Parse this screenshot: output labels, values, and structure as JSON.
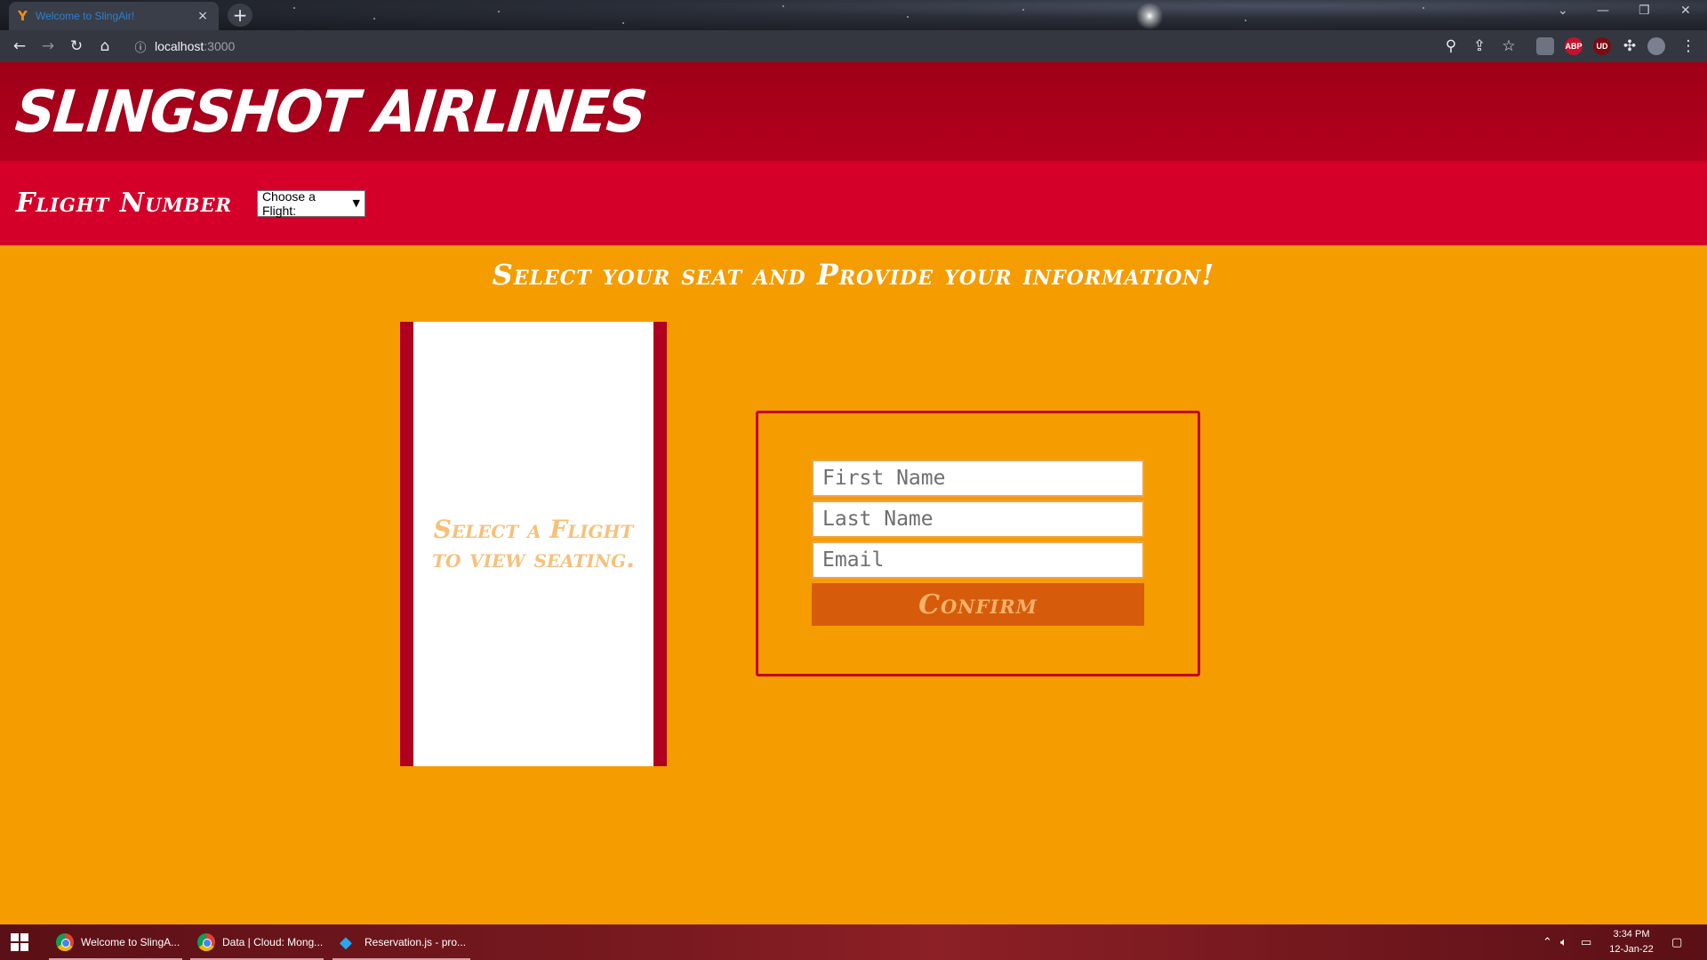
{
  "browser": {
    "tab_title": "Welcome to SlingAir!",
    "tab_favicon": "Y",
    "tab_close": "×",
    "new_tab": "+",
    "url_host": "localhost",
    "url_port": ":3000",
    "nav_icons": {
      "back": "←",
      "forward": "→",
      "reload": "↻",
      "home": "⌂",
      "info": "ⓘ"
    },
    "toolbar_icons": {
      "zoom": "⚲",
      "share": "⇪",
      "bookmark": "☆",
      "extensions": "✣",
      "menu": "⋮"
    },
    "ext_labels": [
      "ABP",
      "UD"
    ],
    "window_controls": {
      "minimize": "—",
      "maximize": "❐",
      "close": "✕",
      "tabsearch": "⌄"
    }
  },
  "page": {
    "logo": "SLINGSHOT AIRLINES",
    "flight_label": "Flight Number",
    "flight_select": "Choose a Flight:",
    "subheading": "Select your seat and Provide your information!",
    "seat_message_line1": "Select a Flight",
    "seat_message_line2": "to view seating.",
    "form": {
      "first_name_placeholder": "First Name",
      "last_name_placeholder": "Last Name",
      "email_placeholder": "Email",
      "confirm_label": "Confirm"
    }
  },
  "taskbar": {
    "apps": [
      {
        "label": "Welcome to SlingA..."
      },
      {
        "label": "Data | Cloud: Mong..."
      },
      {
        "label": "Reservation.js - pro..."
      }
    ],
    "time": "3:34 PM",
    "date": "12-Jan-22"
  },
  "colors": {
    "header_bg": "#a8001d",
    "flight_bar_bg": "#d4002a",
    "page_bg": "#f59c00",
    "seat_border": "#b0001f",
    "seat_text": "#f7c07a",
    "form_border": "#c4001f",
    "confirm_bg": "#d65c0c",
    "confirm_text": "#f6b168"
  }
}
